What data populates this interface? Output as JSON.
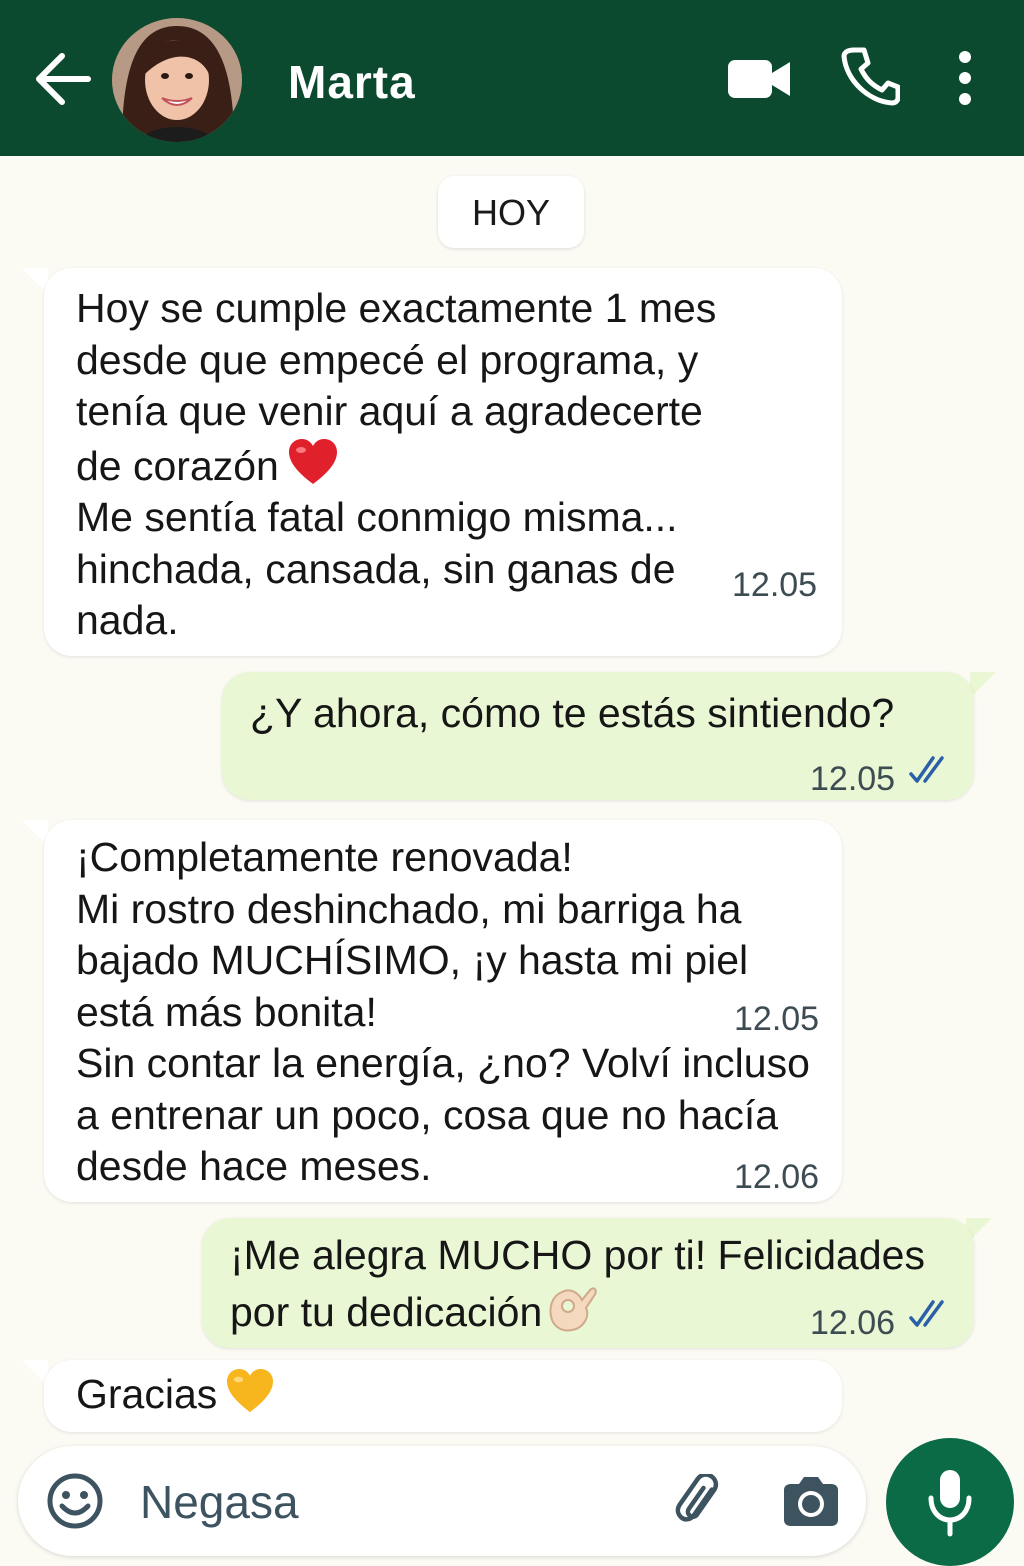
{
  "header": {
    "contact_name": "Marta",
    "back_icon": "arrow-left-icon",
    "video_icon": "video-camera-icon",
    "call_icon": "phone-icon",
    "menu_icon": "more-vertical-icon",
    "background_color": "#0B4A2E"
  },
  "date_separator": "HOY",
  "messages": [
    {
      "direction": "incoming",
      "lines": [
        "Hoy se cumple exactamente 1 mes",
        "desde que empecé el programa, y",
        "tenía que venir aquí a agradecerte",
        "de corazón",
        "Me sentía fatal conmigo misma...",
        "hinchada, cansada, sin ganas de",
        "nada."
      ],
      "emoji": "red-heart",
      "time": "12.05"
    },
    {
      "direction": "outgoing",
      "lines": [
        "¿Y ahora, cómo te estás sintiendo?"
      ],
      "time": "12.05",
      "status": "read"
    },
    {
      "direction": "incoming",
      "lines": [
        "¡Completamente renovada!",
        "Mi rostro deshinchado, mi barriga ha",
        "bajado MUCHÍSIMO, ¡y hasta mi piel",
        "está más bonita!",
        "Sin contar la energía, ¿no? Volví incluso",
        "a entrenar un poco, cosa que no hacía",
        "desde hace meses."
      ],
      "time_first": "12.05",
      "time": "12.06"
    },
    {
      "direction": "outgoing",
      "lines": [
        "¡Me alegra MUCHO por ti! Felicidades",
        "por tu dedicación"
      ],
      "emoji": "ok-hand",
      "time": "12.06",
      "status": "read"
    },
    {
      "direction": "incoming",
      "lines": [
        "Gracias"
      ],
      "emoji": "yellow-heart"
    }
  ],
  "composer": {
    "placeholder": "Negasa",
    "emoji_icon": "smiley-icon",
    "attach_icon": "paperclip-icon",
    "camera_icon": "camera-icon",
    "mic_icon": "microphone-icon",
    "accent_color": "#0B6B47"
  },
  "colors": {
    "chat_background": "#FBFAF3",
    "incoming_bubble": "#FFFFFF",
    "outgoing_bubble": "#E9F7D4",
    "read_ticks": "#2B5FA8"
  }
}
